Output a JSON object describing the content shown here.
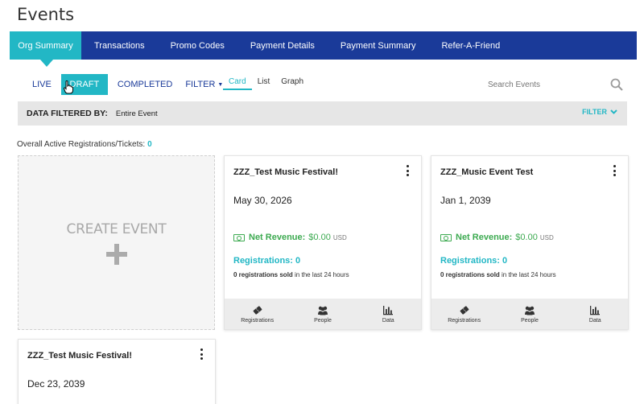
{
  "page": {
    "title": "Events"
  },
  "tabs": [
    {
      "label": "Org Summary",
      "active": true
    },
    {
      "label": "Transactions"
    },
    {
      "label": "Promo Codes"
    },
    {
      "label": "Payment Details"
    },
    {
      "label": "Payment Summary"
    },
    {
      "label": "Refer-A-Friend"
    }
  ],
  "statuses": {
    "live": "LIVE",
    "draft": "DRAFT",
    "completed": "COMPLETED",
    "filter": "FILTER"
  },
  "views": {
    "card": "Card",
    "list": "List",
    "graph": "Graph"
  },
  "search": {
    "placeholder": "Search Events"
  },
  "filter_bar": {
    "label": "DATA FILTERED BY:",
    "value": "Entire Event",
    "toggle": "FILTER"
  },
  "overall": {
    "label": "Overall Active Registrations/Tickets:",
    "count": "0"
  },
  "create": {
    "label": "CREATE EVENT"
  },
  "events": [
    {
      "title": "ZZZ_Test Music Festival!",
      "date": "May 30, 2026",
      "revenue_label": "Net Revenue:",
      "revenue_value": "$0.00",
      "currency": "USD",
      "registrations": "Registrations: 0",
      "sold_count": "0 registrations sold",
      "sold_suffix": "in the last 24 hours",
      "footer": [
        "Registrations",
        "People",
        "Data"
      ]
    },
    {
      "title": "ZZZ_Music Event Test",
      "date": "Jan 1, 2039",
      "revenue_label": "Net Revenue:",
      "revenue_value": "$0.00",
      "currency": "USD",
      "registrations": "Registrations: 0",
      "sold_count": "0 registrations sold",
      "sold_suffix": "in the last 24 hours",
      "footer": [
        "Registrations",
        "People",
        "Data"
      ]
    },
    {
      "title": "ZZZ_Test Music Festival!",
      "date": "Dec 23, 2039"
    }
  ],
  "colors": {
    "nav": "#1a3a99",
    "accent": "#22b7c5",
    "revenue": "#3caa50"
  }
}
